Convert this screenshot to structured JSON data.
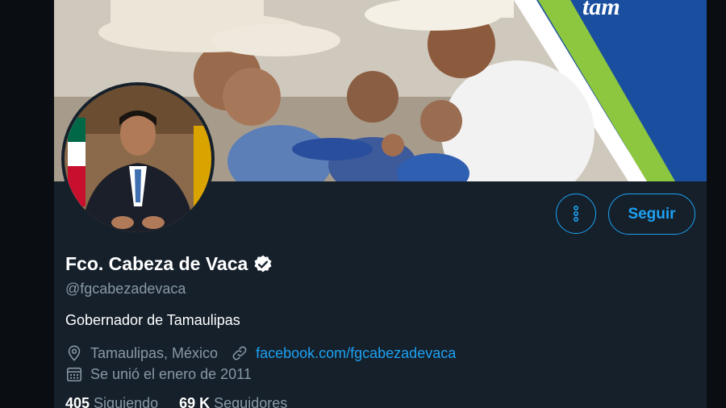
{
  "profile": {
    "display_name": "Fco. Cabeza de Vaca",
    "handle": "@fgcabezadevaca",
    "bio": "Gobernador de Tamaulipas",
    "location": "Tamaulipas, México",
    "website": "facebook.com/fgcabezadevaca",
    "joined": "Se unió el enero de 2011",
    "banner_text": "tam"
  },
  "actions": {
    "follow_label": "Seguir"
  },
  "stats": {
    "following_count": "405",
    "following_label": "Siguiendo",
    "followers_count": "69 K",
    "followers_label": "Seguidores"
  },
  "icons": {
    "more": "more-vertical-icon",
    "verified": "verified-badge-icon",
    "location": "location-pin-icon",
    "link": "link-icon",
    "calendar": "calendar-icon"
  },
  "colors": {
    "background": "#15202b",
    "accent": "#1da1f2",
    "secondary_text": "#8899a6",
    "primary_text": "#ffffff"
  }
}
